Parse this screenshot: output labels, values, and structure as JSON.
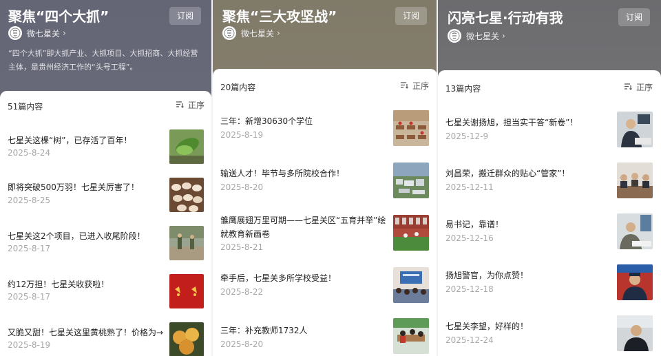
{
  "panels": [
    {
      "title": "聚焦“四个大抓”",
      "subscribe_label": "订阅",
      "author": "微七星关",
      "description": "“四个大抓”即大抓产业、大抓项目、大抓招商、大抓经营主体，是贵州经济工作的“头号工程”。",
      "count_label": "51篇内容",
      "sort_label": "正序",
      "items": [
        {
          "title": "七星关这棵“树”，已存活了百年！",
          "date": "2025-8-24",
          "thumb": "leaf-photo"
        },
        {
          "title": "即将突破500万羽！七星关厉害了！",
          "date": "2025-8-25",
          "thumb": "eggs-photo"
        },
        {
          "title": "七星关这2个项目，已进入收尾阶段！",
          "date": "2025-8-17",
          "thumb": "workers-photo"
        },
        {
          "title": "约12万担！七星关收获啦！",
          "date": "2025-8-17",
          "thumb": "red-banner-photo"
        },
        {
          "title": "又脆又甜！七星关这里黄桃熟了！价格为→",
          "date": "2025-8-19",
          "thumb": "peach-photo"
        }
      ]
    },
    {
      "title": "聚焦“三大攻坚战”",
      "subscribe_label": "订阅",
      "author": "微七星关",
      "count_label": "20篇内容",
      "sort_label": "正序",
      "items": [
        {
          "title": "三年：新增30630个学位",
          "date": "2025-8-19",
          "thumb": "classroom-photo"
        },
        {
          "title": "输送人才！毕节与多所院校合作！",
          "date": "2025-8-20",
          "thumb": "campus-aerial-photo"
        },
        {
          "title": "雏鹰展翅万里可期——七星关区“五育并举”绘就教育新画卷",
          "date": "2025-8-21",
          "thumb": "sports-field-photo"
        },
        {
          "title": "牵手后，七星关多所学校受益！",
          "date": "2025-8-22",
          "thumb": "students-photo"
        },
        {
          "title": "三年：补充教师1732人",
          "date": "2025-8-20",
          "thumb": "teachers-photo"
        }
      ]
    },
    {
      "title": "闪亮七星·行动有我",
      "subscribe_label": "订阅",
      "author": "微七星关",
      "count_label": "13篇内容",
      "sort_label": "正序",
      "items": [
        {
          "title": "七星关谢扬旭，担当实干答“新卷”！",
          "date": "2025-12-9",
          "thumb": "officer-desk-photo"
        },
        {
          "title": "刘昌荣，搬迁群众的贴心“管家”！",
          "date": "2025-12-11",
          "thumb": "meeting-photo"
        },
        {
          "title": "易书记，靠谱！",
          "date": "2025-12-16",
          "thumb": "office-worker-photo"
        },
        {
          "title": "扬旭警官，为你点赞！",
          "date": "2025-12-18",
          "thumb": "police-photo"
        },
        {
          "title": "七星关李望，好样的！",
          "date": "2025-12-24",
          "thumb": "man-portrait-photo"
        }
      ]
    }
  ],
  "colors": {
    "panel_1_bg": "#6b6c7a",
    "panel_2_bg": "#877f6e",
    "panel_3_bg": "#747477",
    "date_text": "#a8a8a8",
    "title_text": "#222222"
  }
}
